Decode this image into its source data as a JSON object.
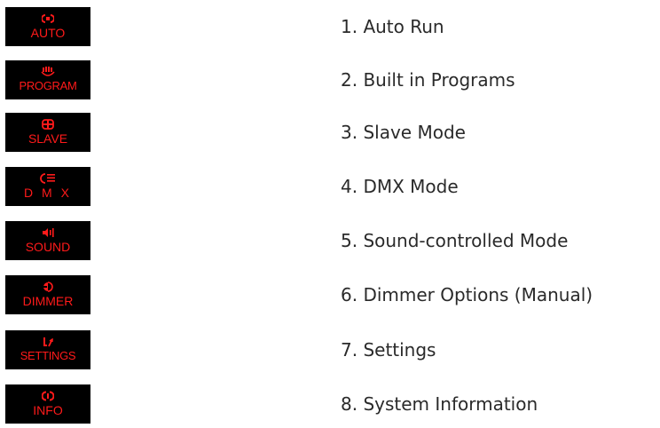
{
  "accent_color": "#ff1a1a",
  "icon_background": "#000000",
  "items": [
    {
      "icon": "auto-run-icon",
      "label": "AUTO",
      "text": "1. Auto Run"
    },
    {
      "icon": "program-icon",
      "label": "PROGRAM",
      "text": "2. Built in Programs"
    },
    {
      "icon": "slave-icon",
      "label": "SLAVE",
      "text": "3. Slave Mode"
    },
    {
      "icon": "dmx-icon",
      "label": "D M X",
      "text": "4. DMX Mode"
    },
    {
      "icon": "sound-icon",
      "label": "SOUND",
      "text": "5. Sound-controlled Mode"
    },
    {
      "icon": "dimmer-icon",
      "label": "DIMMER",
      "text": "6. Dimmer Options (Manual)"
    },
    {
      "icon": "settings-icon",
      "label": "SETTINGS",
      "text": "7. Settings"
    },
    {
      "icon": "info-icon",
      "label": "INFO",
      "text": "8. System Information"
    }
  ]
}
